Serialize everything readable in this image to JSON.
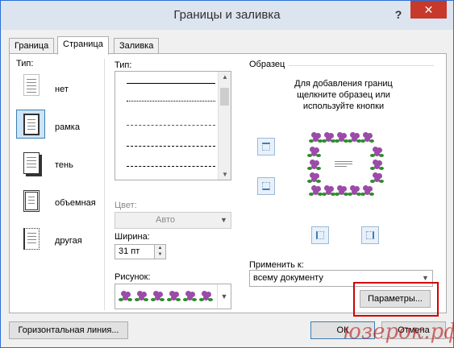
{
  "window": {
    "title": "Границы и заливка",
    "help": "?",
    "close": "✕"
  },
  "tabs": [
    {
      "label": "Граница",
      "active": false
    },
    {
      "label": "Страница",
      "active": true
    },
    {
      "label": "Заливка",
      "active": false
    }
  ],
  "setting": {
    "label": "Тип:",
    "items": [
      {
        "label": "нет",
        "selected": false
      },
      {
        "label": "рамка",
        "selected": true
      },
      {
        "label": "тень",
        "selected": false
      },
      {
        "label": "объемная",
        "selected": false
      },
      {
        "label": "другая",
        "selected": false
      }
    ]
  },
  "style": {
    "label": "Тип:",
    "lines": [
      "solid",
      "dotted",
      "dash-fine",
      "dashed",
      "dash-dot"
    ]
  },
  "color": {
    "label": "Цвет:",
    "value": "Авто"
  },
  "width": {
    "label": "Ширина:",
    "value": "31 пт"
  },
  "art": {
    "label": "Рисунок:"
  },
  "preview": {
    "label": "Образец",
    "hint": "Для добавления границ щелкните образец или используйте кнопки"
  },
  "apply_to": {
    "label": "Применить к:",
    "value": "всему документу"
  },
  "buttons": {
    "options": "Параметры...",
    "horizontal_line": "Горизонтальная линия...",
    "ok": "ОК",
    "cancel": "Отмена"
  },
  "watermark": "юзерок.рф",
  "colors": {
    "accent": "#3c7fb1",
    "highlight": "#d40000",
    "close": "#c7392b"
  }
}
